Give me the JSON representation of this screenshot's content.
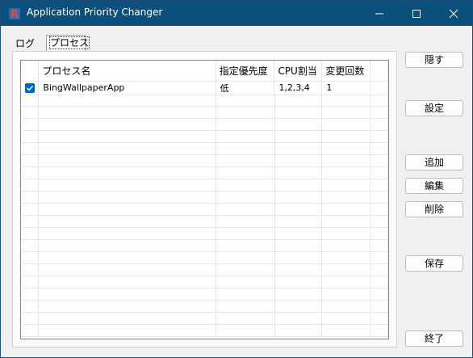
{
  "window": {
    "title": "Application Priority Changer"
  },
  "tabs": [
    {
      "label": "ログ",
      "selected": false
    },
    {
      "label": "プロセス",
      "selected": true
    }
  ],
  "table": {
    "headers": [
      "プロセス名",
      "指定優先度",
      "CPU割当",
      "変更回数"
    ],
    "rows": [
      {
        "checked": true,
        "name": "BingWallpaperApp",
        "priority": "低",
        "cpu": "1,2,3,4",
        "count": "1"
      }
    ]
  },
  "buttons": {
    "hide": "隠す",
    "settings": "設定",
    "add": "追加",
    "edit": "編集",
    "delete": "削除",
    "save": "保存",
    "exit": "終了"
  },
  "colors": {
    "titlebar": "#0b4f7c",
    "accent": "#0067c0"
  }
}
